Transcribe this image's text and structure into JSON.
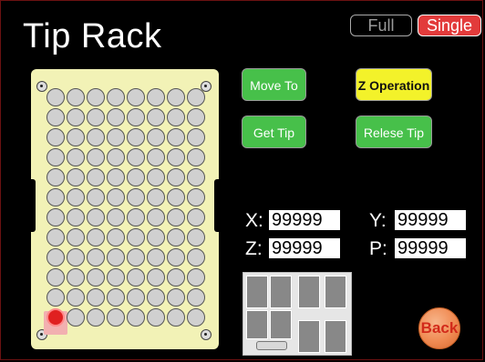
{
  "header": {
    "title": "Tip Rack",
    "mode_full": "Full",
    "mode_single": "Single"
  },
  "buttons": {
    "move_to": "Move To",
    "z_operation": "Z Operation",
    "get_tip": "Get Tip",
    "release_tip": "Relese Tip",
    "back": "Back"
  },
  "coordinates": {
    "x_label": "X:",
    "x_value": "99999",
    "y_label": "Y:",
    "y_value": "99999",
    "z_label": "Z:",
    "z_value": "99999",
    "p_label": "P:",
    "p_value": "99999"
  },
  "rack": {
    "columns": 8,
    "rows": 12,
    "selected_row": 12,
    "selected_column": 1
  },
  "colors": {
    "rack_bg": "#f2f2b6",
    "selected_well": "#e02020",
    "button_green": "#47c04a",
    "button_yellow": "#f3f22a",
    "single_active": "#e23b3b"
  }
}
